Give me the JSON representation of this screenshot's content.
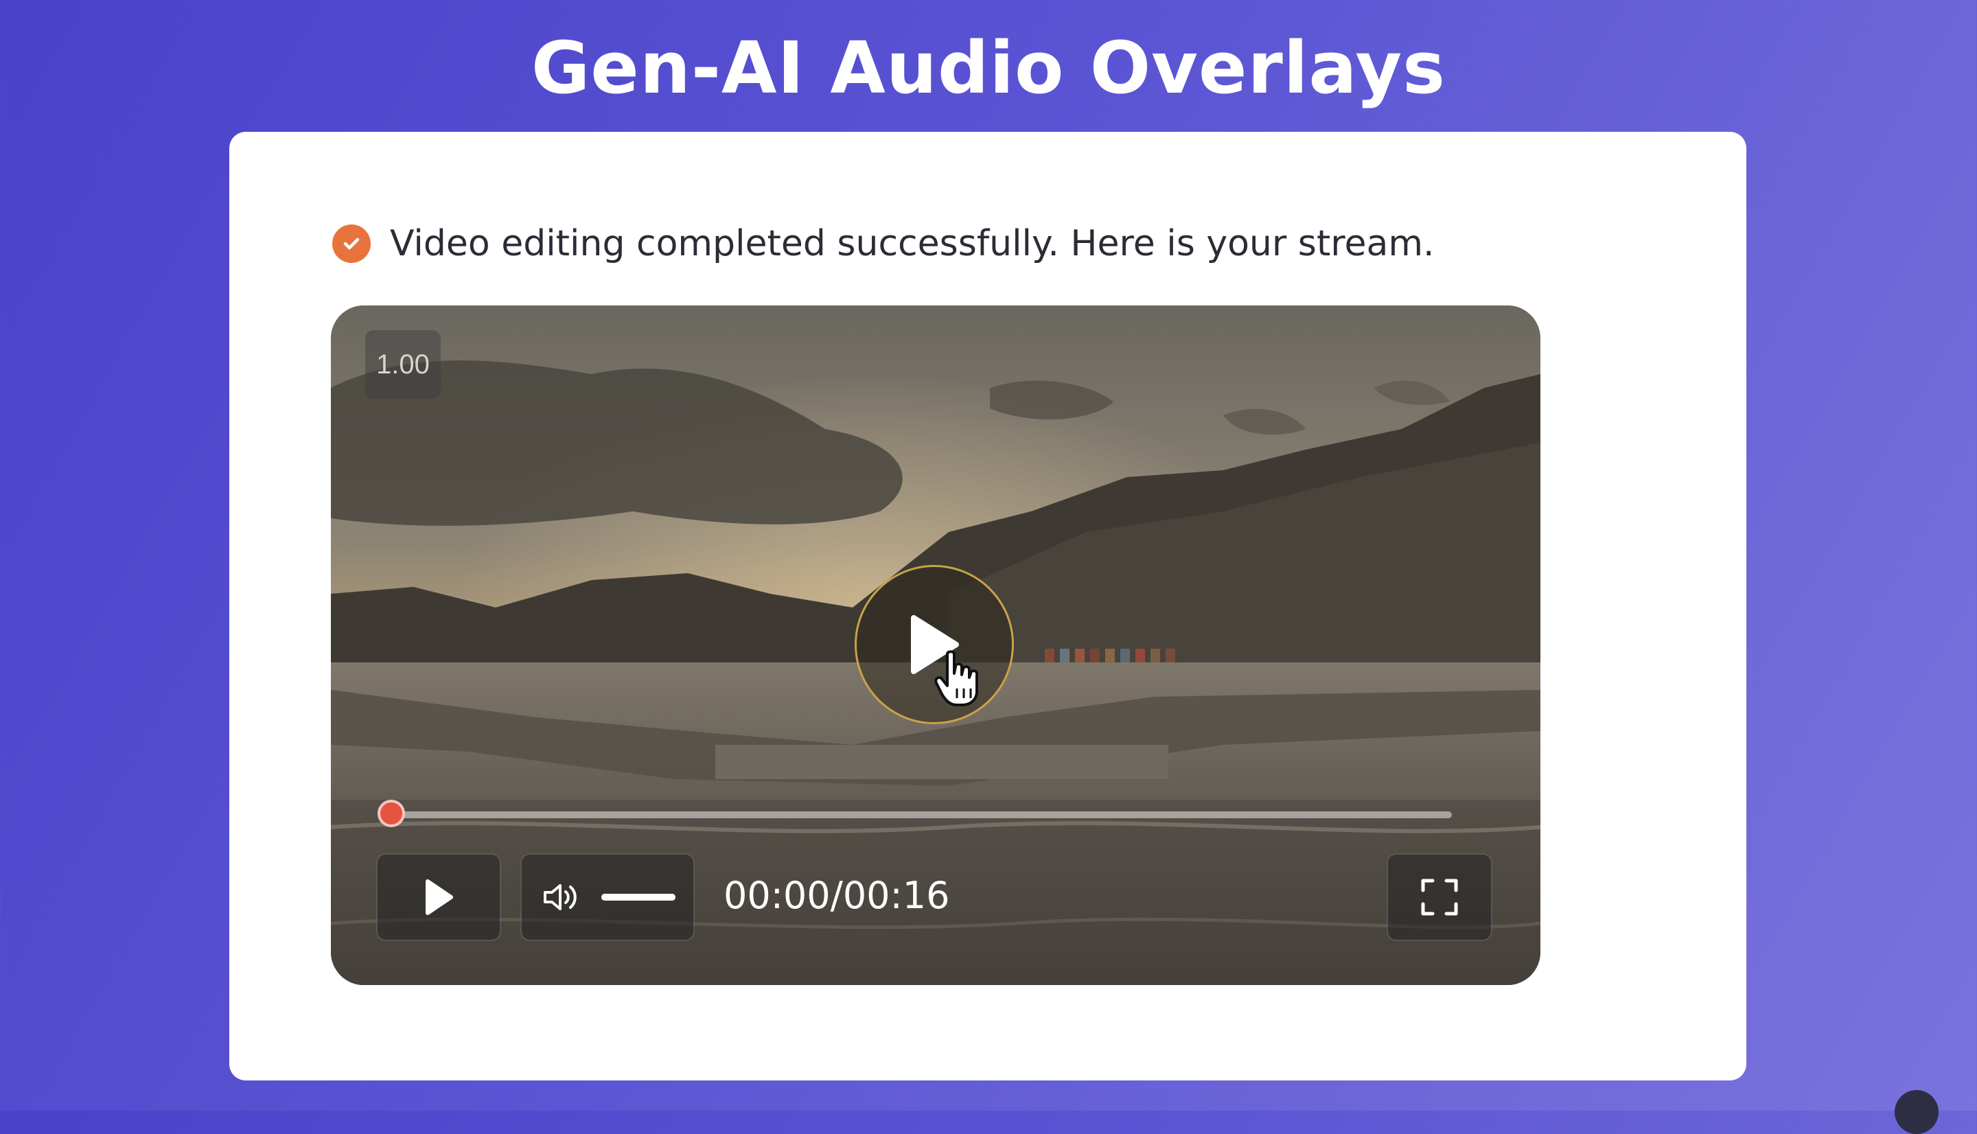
{
  "page": {
    "title": "Gen-AI Audio Overlays"
  },
  "status": {
    "message": "Video editing completed successfully. Here is your stream.",
    "icon": "check-circle-icon",
    "icon_color": "#e8733d"
  },
  "player": {
    "speed": "1.00",
    "time": "00:00/00:16",
    "progress_fraction": 0,
    "volume_fraction": 1,
    "accent_color": "#e24a3b",
    "controls": [
      "play-icon",
      "volume-icon",
      "fullscreen-icon"
    ]
  }
}
